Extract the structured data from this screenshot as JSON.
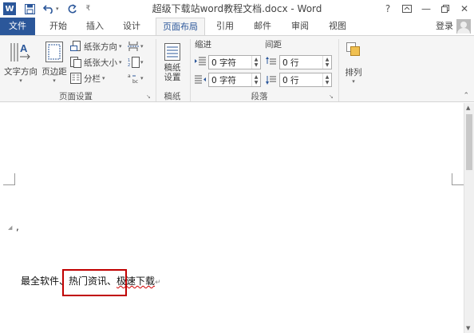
{
  "window": {
    "title": "超级下载站word教程文档.docx - Word"
  },
  "titlebar_buttons": {
    "help": "?",
    "minimize": "—",
    "close": "✕"
  },
  "tabs": [
    {
      "label": "文件"
    },
    {
      "label": "开始"
    },
    {
      "label": "插入"
    },
    {
      "label": "设计"
    },
    {
      "label": "页面布局"
    },
    {
      "label": "引用"
    },
    {
      "label": "邮件"
    },
    {
      "label": "审阅"
    },
    {
      "label": "视图"
    }
  ],
  "account": {
    "login_label": "登录"
  },
  "ribbon": {
    "page_setup": {
      "text_direction": "文字方向",
      "margins": "页边距",
      "orientation": "纸张方向",
      "size": "纸张大小",
      "columns": "分栏",
      "group_label": "页面设置"
    },
    "manuscript": {
      "button_line1": "稿纸",
      "button_line2": "设置",
      "group_label": "稿纸"
    },
    "paragraph": {
      "indent_label": "缩进",
      "spacing_label": "间距",
      "indent_left_value": "0 字符",
      "indent_right_value": "0 字符",
      "spacing_before_value": "0 行",
      "spacing_after_value": "0 行",
      "group_label": "段落"
    },
    "arrange": {
      "label": "排列"
    }
  },
  "document": {
    "paragraph_parts": [
      "最全软件、",
      "热门资讯",
      "、",
      "极速下载"
    ],
    "cursor_char": "↵",
    "stray_mark": ","
  },
  "colors": {
    "file_tab": "#2b579a",
    "highlight_box": "#c00000",
    "active_tab_text": "#2b579a"
  }
}
